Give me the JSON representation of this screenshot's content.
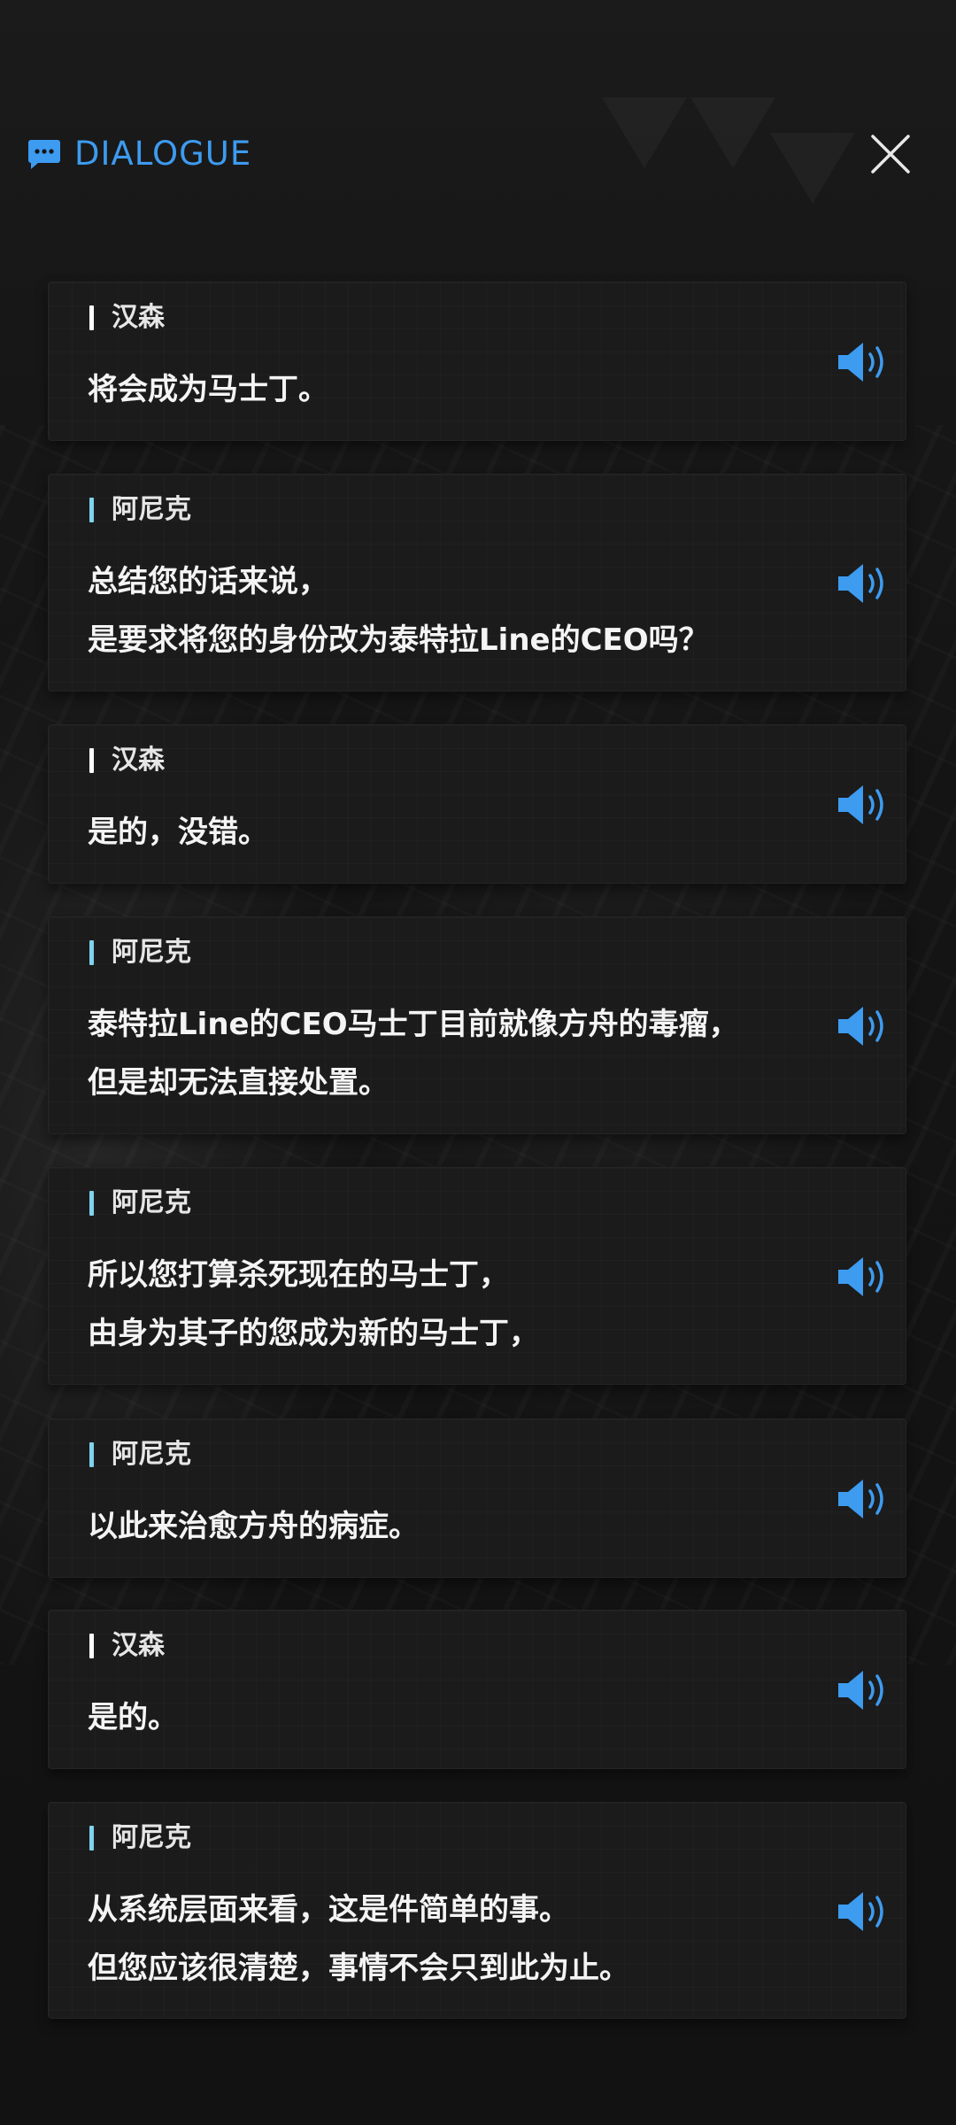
{
  "header": {
    "title": "DIALOGUE",
    "accent_color": "#3d9bf0",
    "icon": "chat-bubble-icon",
    "close_icon": "close-icon"
  },
  "speaker_colors": {
    "汉森": "#ffffff",
    "阿尼克": "#7fd3ec"
  },
  "dialogue": [
    {
      "speaker": "汉森",
      "text": "将会成为马士丁。"
    },
    {
      "speaker": "阿尼克",
      "text": "总结您的话来说，\n是要求将您的身份改为泰特拉Line的CEO吗？"
    },
    {
      "speaker": "汉森",
      "text": "是的，没错。"
    },
    {
      "speaker": "阿尼克",
      "text": "泰特拉Line的CEO马士丁目前就像方舟的毒瘤，\n但是却无法直接处置。"
    },
    {
      "speaker": "阿尼克",
      "text": "所以您打算杀死现在的马士丁，\n由身为其子的您成为新的马士丁，"
    },
    {
      "speaker": "阿尼克",
      "text": "以此来治愈方舟的病症。"
    },
    {
      "speaker": "汉森",
      "text": "是的。"
    },
    {
      "speaker": "阿尼克",
      "text": "从系统层面来看，这是件简单的事。\n但您应该很清楚，事情不会只到此为止。"
    }
  ],
  "voice_icon": "speaker-volume-icon"
}
